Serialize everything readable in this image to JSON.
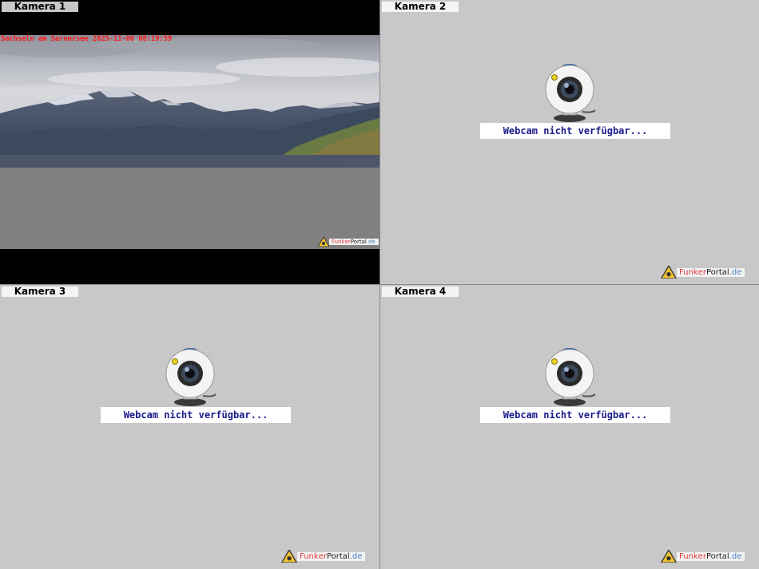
{
  "cameras": [
    {
      "label": "Kamera 1",
      "status": "live",
      "overlay": "Sachseln am Sarnersee 2025-11-06 08:19:59"
    },
    {
      "label": "Kamera 2",
      "status": "offline",
      "message": "Webcam nicht verfügbar..."
    },
    {
      "label": "Kamera 3",
      "status": "offline",
      "message": "Webcam nicht verfügbar..."
    },
    {
      "label": "Kamera 4",
      "status": "offline",
      "message": "Webcam nicht verfügbar..."
    }
  ],
  "watermark": {
    "part1": "Funk",
    "part2": "er",
    "part3": "Portal",
    "part4": ".de"
  },
  "colors": {
    "overlay_text": "#ff1a1a",
    "message_text": "#1a1a8a",
    "background": "#c8c8c8"
  }
}
